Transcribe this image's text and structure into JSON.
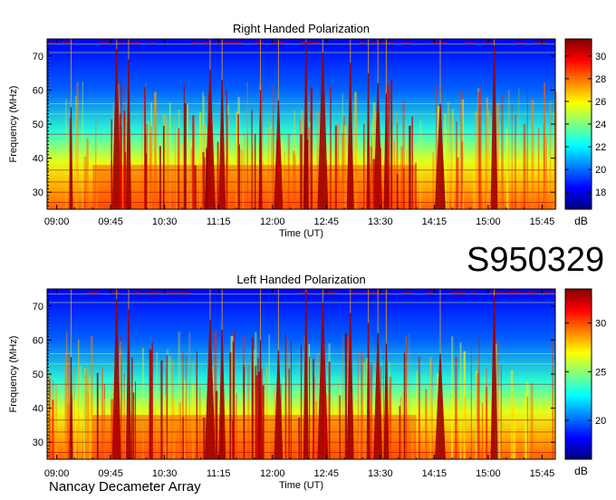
{
  "session_id": "S950329",
  "instrument": "Nancay Decameter Array",
  "chart_data": [
    {
      "type": "heatmap",
      "title": "Right Handed Polarization",
      "xlabel": "Time (UT)",
      "ylabel": "Frequency (MHz)",
      "xticks": [
        "09:00",
        "09:45",
        "10:30",
        "11:15",
        "12:00",
        "12:45",
        "13:30",
        "14:15",
        "15:00",
        "15:45"
      ],
      "yticks": [
        30,
        40,
        50,
        60,
        70
      ],
      "ylim": [
        25,
        75
      ],
      "xlim": [
        "08:52",
        "15:56"
      ],
      "colorbar": {
        "label": "dB",
        "ticks": [
          18,
          20,
          22,
          24,
          26,
          28,
          30
        ],
        "range": [
          16.5,
          31.5
        ],
        "colormap": "jet"
      },
      "description_bursts_hhmm": [
        "09:12",
        "09:50",
        "10:00",
        "11:08",
        "11:18",
        "11:50",
        "12:05",
        "12:28",
        "12:42",
        "13:05",
        "13:20",
        "13:28",
        "13:35",
        "14:20",
        "15:05"
      ]
    },
    {
      "type": "heatmap",
      "title": "Left Handed Polarization",
      "xlabel": "Time (UT)",
      "ylabel": "Frequency (MHz)",
      "xticks": [
        "09:00",
        "09:45",
        "10:30",
        "11:15",
        "12:00",
        "12:45",
        "13:30",
        "14:15",
        "15:00",
        "15:45"
      ],
      "yticks": [
        30,
        40,
        50,
        60,
        70
      ],
      "ylim": [
        25,
        75
      ],
      "xlim": [
        "08:52",
        "15:56"
      ],
      "colorbar": {
        "label": "dB",
        "ticks": [
          20,
          25,
          30
        ],
        "range": [
          16,
          33.5
        ],
        "colormap": "jet"
      },
      "description_bursts_hhmm": [
        "09:12",
        "09:50",
        "10:00",
        "11:08",
        "11:18",
        "11:50",
        "12:05",
        "12:28",
        "12:42",
        "13:05",
        "13:20",
        "13:28",
        "13:35",
        "14:20",
        "15:05"
      ]
    }
  ]
}
